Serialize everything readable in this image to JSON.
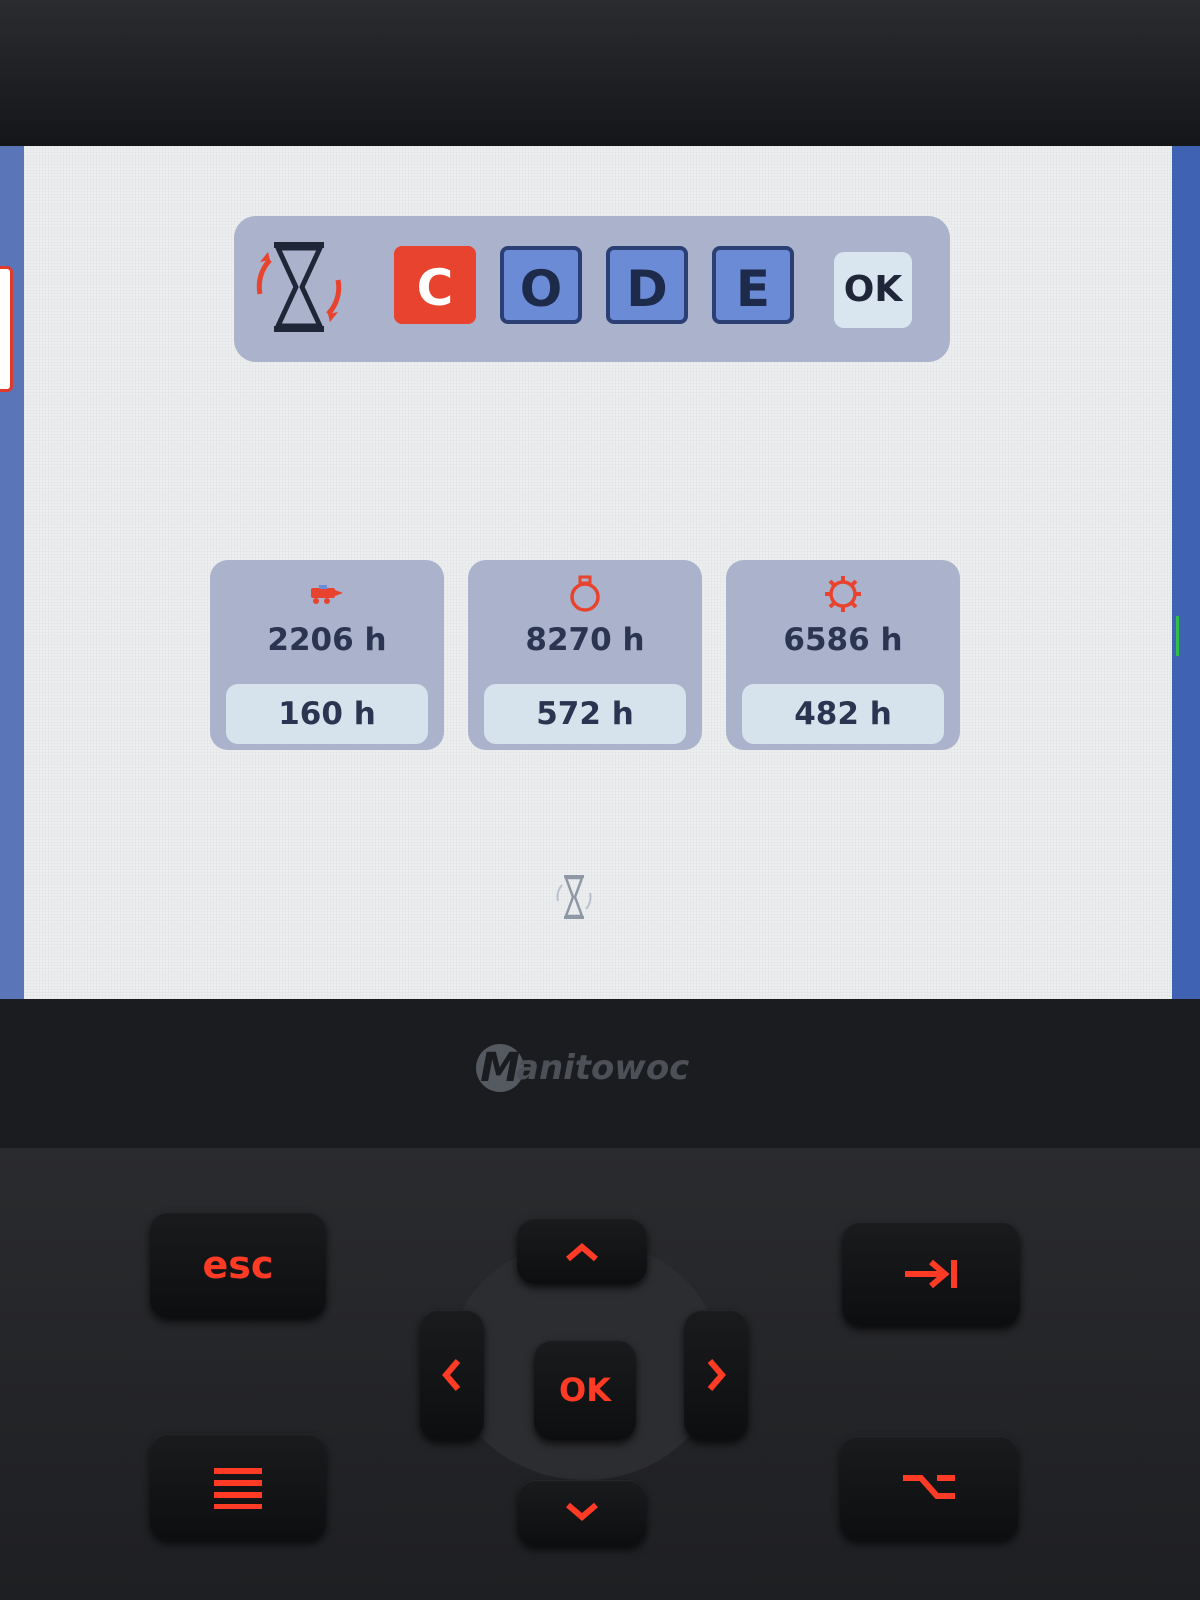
{
  "code_entry": {
    "letters": [
      "C",
      "O",
      "D",
      "E"
    ],
    "active_index": 0,
    "confirm_label": "OK"
  },
  "hours_counters": [
    {
      "icon": "crane-carrier-icon",
      "total": "2206 h",
      "since_service": "160 h"
    },
    {
      "icon": "engine-icon",
      "total": "8270 h",
      "since_service": "572 h"
    },
    {
      "icon": "gear-icon",
      "total": "6586 h",
      "since_service": "482 h"
    }
  ],
  "brand": {
    "badge": "M",
    "word": "anitowoc"
  },
  "keypad": {
    "esc": "esc",
    "ok": "OK",
    "up": "^",
    "down": "v",
    "left": "<",
    "right": ">"
  },
  "colors": {
    "accent": "#e8432e",
    "panel": "#aab3cb",
    "letter_idle": "#6b8bd6",
    "key_glow": "#ff3b26"
  }
}
